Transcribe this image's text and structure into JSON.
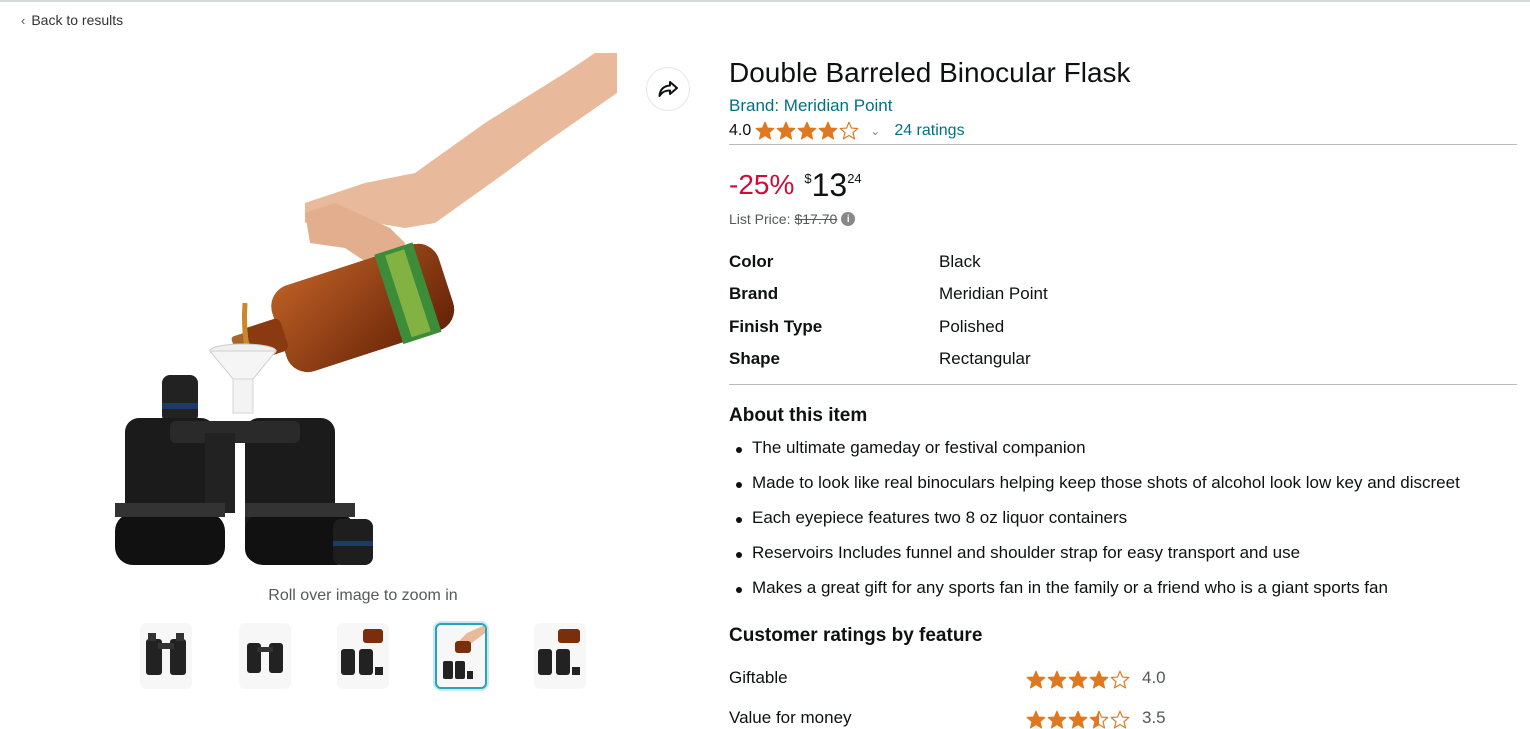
{
  "nav": {
    "back_label": "Back to results"
  },
  "gallery": {
    "zoom_hint": "Roll over image to zoom in",
    "thumbnail_count": 5,
    "selected_thumbnail": 4
  },
  "product": {
    "title": "Double Barreled Binocular Flask",
    "brand_link": "Brand: Meridian Point",
    "rating_value": "4.0",
    "rating_stars": 4,
    "ratings_count": "24 ratings",
    "discount": "-25%",
    "price_currency": "$",
    "price_whole": "13",
    "price_fraction": "24",
    "list_price_label": "List Price:",
    "list_price_value": "$17.70"
  },
  "specs": [
    {
      "key": "Color",
      "value": "Black"
    },
    {
      "key": "Brand",
      "value": "Meridian Point"
    },
    {
      "key": "Finish Type",
      "value": "Polished"
    },
    {
      "key": "Shape",
      "value": "Rectangular"
    }
  ],
  "about": {
    "heading": "About this item",
    "bullets": [
      "The ultimate gameday or festival companion",
      "Made to look like real binoculars helping keep those shots of alcohol look low key and discreet",
      "Each eyepiece features two 8 oz liquor containers",
      "Reservoirs Includes funnel and shoulder strap for easy transport and use",
      "Makes a great gift for any sports fan in the family or a friend who is a giant sports fan"
    ]
  },
  "feature_ratings": {
    "heading": "Customer ratings by feature",
    "rows": [
      {
        "name": "Giftable",
        "value": "4.0",
        "stars": 4
      },
      {
        "name": "Value for money",
        "value": "3.5",
        "stars": 3.5
      }
    ]
  },
  "colors": {
    "link": "#007185",
    "discount": "#cc0c39",
    "star": "#de7921",
    "selected_border": "#2ba3b6"
  },
  "icons": [
    "chevron-left-icon",
    "share-icon",
    "star-icon",
    "caret-down-icon",
    "info-icon"
  ]
}
